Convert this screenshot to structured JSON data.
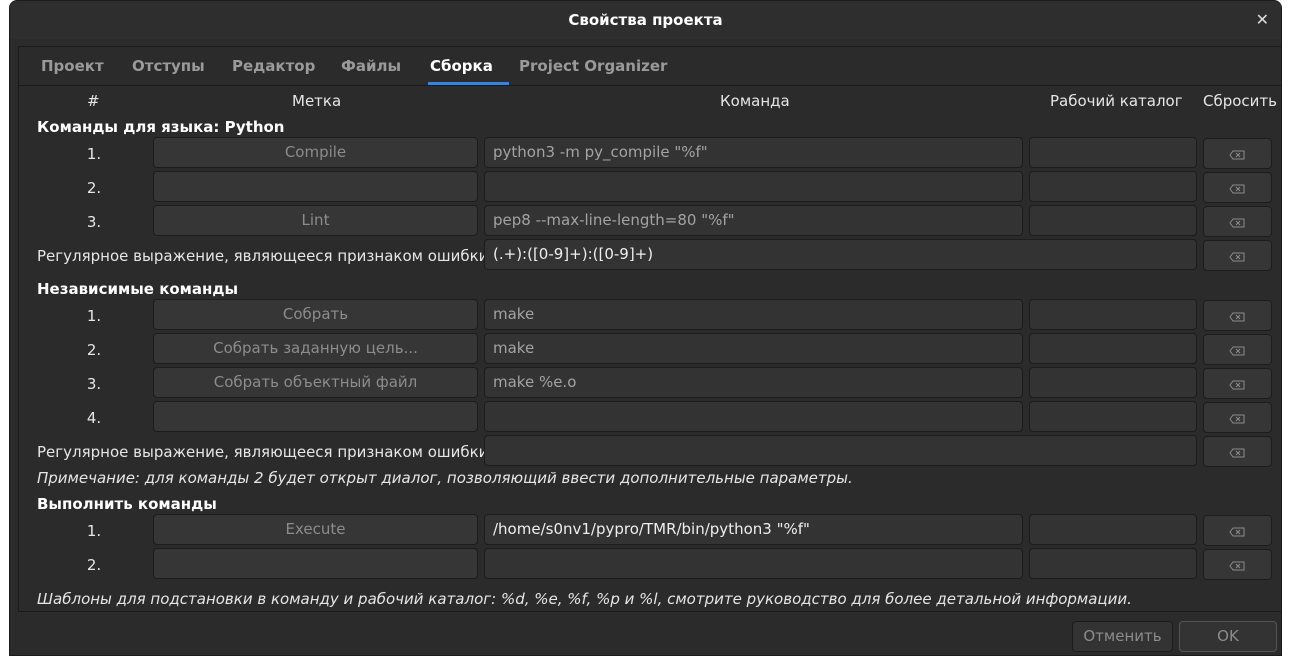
{
  "window": {
    "title": "Свойства проекта"
  },
  "tabs": [
    {
      "label": "Проект"
    },
    {
      "label": "Отступы"
    },
    {
      "label": "Редактор"
    },
    {
      "label": "Файлы"
    },
    {
      "label": "Сборка"
    },
    {
      "label": "Project Organizer"
    }
  ],
  "active_tab": "Сборка",
  "columns": {
    "num": "#",
    "label": "Метка",
    "command": "Команда",
    "workdir": "Рабочий каталог",
    "reset": "Сбросить"
  },
  "python": {
    "title": "Команды для языка: Python",
    "rows": [
      {
        "num": "1.",
        "label": "Compile",
        "command": "python3 -m py_compile \"%f\"",
        "workdir": ""
      },
      {
        "num": "2.",
        "label": "",
        "command": "",
        "workdir": ""
      },
      {
        "num": "3.",
        "label": "Lint",
        "command": "pep8 --max-line-length=80 \"%f\"",
        "workdir": ""
      }
    ],
    "regex_label": "Регулярное выражение, являющееся признаком ошибки:",
    "regex_value": "(.+):([0-9]+):([0-9]+)"
  },
  "independent": {
    "title": "Независимые команды",
    "rows": [
      {
        "num": "1.",
        "label": "Собрать",
        "command": "make",
        "workdir": ""
      },
      {
        "num": "2.",
        "label": "Собрать заданную цель...",
        "command": "make",
        "workdir": ""
      },
      {
        "num": "3.",
        "label": "Собрать объектный файл",
        "command": "make %e.o",
        "workdir": ""
      },
      {
        "num": "4.",
        "label": "",
        "command": "",
        "workdir": ""
      }
    ],
    "regex_label": "Регулярное выражение, являющееся признаком ошибки:",
    "regex_value": "",
    "note": "Примечание: для команды 2 будет открыт диалог, позволяющий ввести дополнительные параметры."
  },
  "execute": {
    "title": "Выполнить команды",
    "rows": [
      {
        "num": "1.",
        "label": "Execute",
        "command": "/home/s0nv1/pypro/TMR/bin/python3 \"%f\"",
        "workdir": ""
      },
      {
        "num": "2.",
        "label": "",
        "command": "",
        "workdir": ""
      }
    ]
  },
  "footer_note": "Шаблоны для подстановки в команду и рабочий каталог: %d, %e, %f, %p и %l, смотрите руководство для более детальной информации.",
  "buttons": {
    "cancel": "Отменить",
    "ok": "OK"
  },
  "icons": {
    "close": "close-icon",
    "reset": "clear-backspace-icon"
  },
  "colors": {
    "accent": "#3584e4",
    "background": "#2b2b2b"
  }
}
